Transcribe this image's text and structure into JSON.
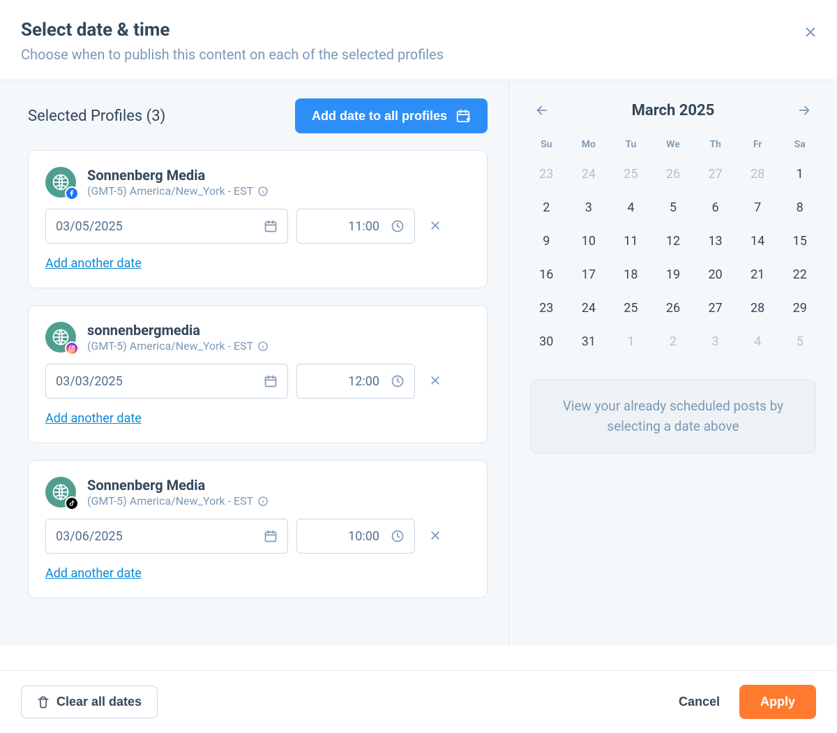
{
  "header": {
    "title": "Select date & time",
    "subtitle": "Choose when to publish this content on each of the selected profiles"
  },
  "left": {
    "selected_profiles_label": "Selected Profiles (3)",
    "add_all_label": "Add date to all profiles",
    "add_another_label": "Add another date"
  },
  "profiles": [
    {
      "name": "Sonnenberg Media",
      "tz": "(GMT-5) America/New_York - EST",
      "network": "facebook",
      "date": "03/05/2025",
      "time": "11:00"
    },
    {
      "name": "sonnenbergmedia",
      "tz": "(GMT-5) America/New_York - EST",
      "network": "instagram",
      "date": "03/03/2025",
      "time": "12:00"
    },
    {
      "name": "Sonnenberg Media",
      "tz": "(GMT-5) America/New_York - EST",
      "network": "tiktok",
      "date": "03/06/2025",
      "time": "10:00"
    }
  ],
  "calendar": {
    "title": "March 2025",
    "dow": [
      "Su",
      "Mo",
      "Tu",
      "We",
      "Th",
      "Fr",
      "Sa"
    ],
    "days": [
      {
        "n": "23",
        "out": true
      },
      {
        "n": "24",
        "out": true
      },
      {
        "n": "25",
        "out": true
      },
      {
        "n": "26",
        "out": true
      },
      {
        "n": "27",
        "out": true
      },
      {
        "n": "28",
        "out": true
      },
      {
        "n": "1",
        "out": false
      },
      {
        "n": "2",
        "out": false
      },
      {
        "n": "3",
        "out": false
      },
      {
        "n": "4",
        "out": false
      },
      {
        "n": "5",
        "out": false
      },
      {
        "n": "6",
        "out": false
      },
      {
        "n": "7",
        "out": false
      },
      {
        "n": "8",
        "out": false
      },
      {
        "n": "9",
        "out": false
      },
      {
        "n": "10",
        "out": false
      },
      {
        "n": "11",
        "out": false
      },
      {
        "n": "12",
        "out": false
      },
      {
        "n": "13",
        "out": false
      },
      {
        "n": "14",
        "out": false
      },
      {
        "n": "15",
        "out": false
      },
      {
        "n": "16",
        "out": false
      },
      {
        "n": "17",
        "out": false
      },
      {
        "n": "18",
        "out": false
      },
      {
        "n": "19",
        "out": false
      },
      {
        "n": "20",
        "out": false
      },
      {
        "n": "21",
        "out": false
      },
      {
        "n": "22",
        "out": false
      },
      {
        "n": "23",
        "out": false
      },
      {
        "n": "24",
        "out": false
      },
      {
        "n": "25",
        "out": false
      },
      {
        "n": "26",
        "out": false
      },
      {
        "n": "27",
        "out": false
      },
      {
        "n": "28",
        "out": false
      },
      {
        "n": "29",
        "out": false
      },
      {
        "n": "30",
        "out": false
      },
      {
        "n": "31",
        "out": false
      },
      {
        "n": "1",
        "out": true
      },
      {
        "n": "2",
        "out": true
      },
      {
        "n": "3",
        "out": true
      },
      {
        "n": "4",
        "out": true
      },
      {
        "n": "5",
        "out": true
      }
    ],
    "hint": "View your already scheduled posts by selecting a date above"
  },
  "footer": {
    "clear": "Clear all dates",
    "cancel": "Cancel",
    "apply": "Apply"
  }
}
